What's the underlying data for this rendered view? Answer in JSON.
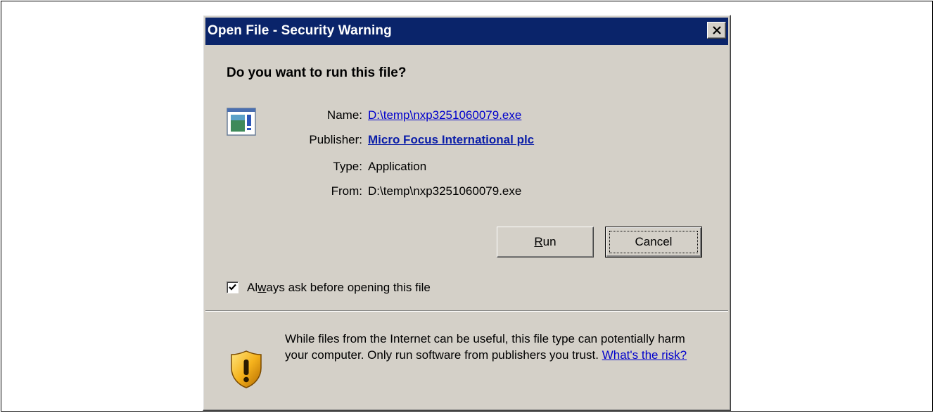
{
  "dialog": {
    "title": "Open File - Security Warning",
    "close_glyph": "✕",
    "question": "Do you want to run this file?",
    "fields": [
      {
        "label": "Name:",
        "value": "D:\\temp\\nxp3251060079.exe"
      },
      {
        "label": "Publisher:",
        "value": "Micro Focus International plc"
      },
      {
        "label": "Type:",
        "value": "Application"
      },
      {
        "label": "From:",
        "value": "D:\\temp\\nxp3251060079.exe"
      }
    ],
    "buttons": {
      "run": {
        "mnemonic": "R",
        "rest": "un"
      },
      "cancel": {
        "label": "Cancel"
      }
    },
    "checkbox": {
      "checked": true,
      "label_before": "Al",
      "label_mnemonic": "w",
      "label_after": "ays ask before opening this file"
    },
    "warning": {
      "text": "While files from the Internet can be useful, this file type can potentially harm your computer. Only run software from publishers you trust.",
      "link": "What's the risk?"
    }
  },
  "icons": {
    "file": "application-file-icon",
    "warning": "security-shield-icon",
    "close": "close-icon",
    "check": "checkmark-icon"
  },
  "colors": {
    "titlebar": "#0a246a",
    "dialog_face": "#d4d0c8",
    "link": "#0000cc"
  }
}
